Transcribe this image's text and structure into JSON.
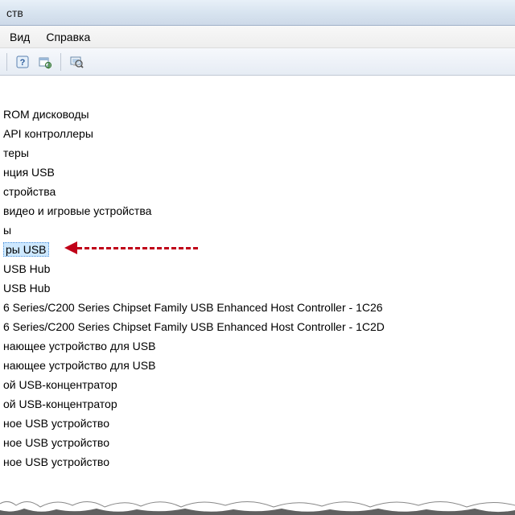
{
  "title_fragment": "ств",
  "menubar": {
    "view_fragment": "Вид",
    "help": "Справка"
  },
  "tree_items": [
    {
      "text": "ROM дисководы",
      "selected": false
    },
    {
      "text": "API контроллеры",
      "selected": false
    },
    {
      "text": "теры",
      "selected": false
    },
    {
      "text": "нция USB",
      "selected": false
    },
    {
      "text": "стройства",
      "selected": false
    },
    {
      "text": "видео и игровые устройства",
      "selected": false
    },
    {
      "text": "ы",
      "selected": false
    },
    {
      "text": "ры USB",
      "selected": true
    },
    {
      "text": " USB Hub",
      "selected": false
    },
    {
      "text": " USB Hub",
      "selected": false
    },
    {
      "text": "6 Series/C200 Series Chipset Family USB Enhanced Host Controller - 1C26",
      "selected": false
    },
    {
      "text": "6 Series/C200 Series Chipset Family USB Enhanced Host Controller - 1C2D",
      "selected": false
    },
    {
      "text": "нающее устройство для USB",
      "selected": false
    },
    {
      "text": "нающее устройство для USB",
      "selected": false
    },
    {
      "text": "ой USB-концентратор",
      "selected": false
    },
    {
      "text": "ой USB-концентратор",
      "selected": false
    },
    {
      "text": "ное USB устройство",
      "selected": false
    },
    {
      "text": "ное USB устройство",
      "selected": false
    },
    {
      "text": "ное USB устройство",
      "selected": false
    }
  ],
  "annotation": {
    "arrow_target": "Контроллеры USB"
  }
}
